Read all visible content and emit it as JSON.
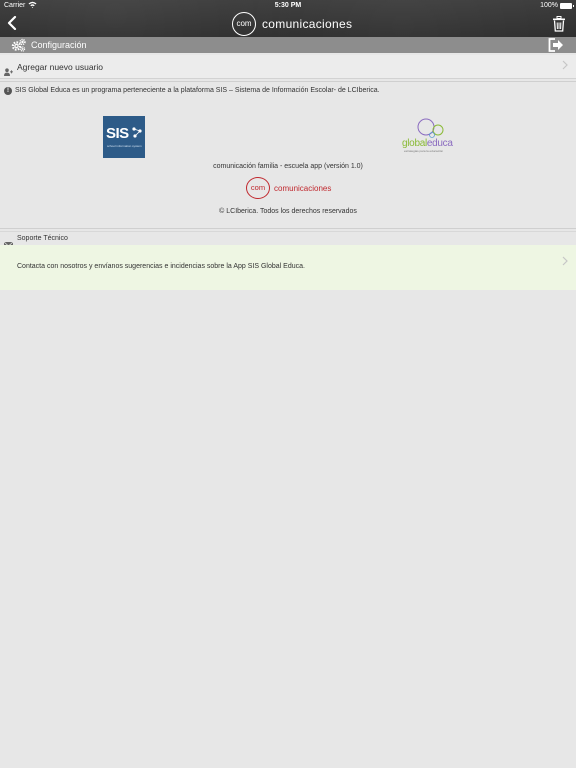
{
  "status_bar": {
    "carrier": "Carrier",
    "time": "5:30 PM",
    "battery": "100%"
  },
  "navbar": {
    "logo_text": "com",
    "title": "comunicaciones",
    "icons": [
      "back-arrow-icon",
      "trash-icon"
    ]
  },
  "config_bar": {
    "label": "Configuración",
    "icons": [
      "gears-icon",
      "logout-icon"
    ]
  },
  "add_user": {
    "label": "Agregar nuevo usuario",
    "icon": "add-user-icon"
  },
  "info": {
    "text": "SIS Global Educa es un programa perteneciente a la plataforma SIS – Sistema de Información Escolar-  de LCIberica."
  },
  "logos": {
    "sis_text": "SIS",
    "sis_sub": "school information system",
    "global_word_1": "global",
    "global_word_2": "educa",
    "global_tag": "estrategias para la educación"
  },
  "about": {
    "app_version": "comunicación familia - escuela app (versión 1.0)",
    "com_logo_text": "com",
    "com_word": "comunicaciones",
    "copyright": "© LCIberica. Todos los derechos reservados"
  },
  "support": {
    "header": "Soporte Técnico",
    "text": "Contacta con nosotros y envíanos sugerencias e incidencias sobre la App SIS Global Educa."
  },
  "colors": {
    "navbar": "#333333",
    "config_bar": "#8d8d8d",
    "support_card": "#eef6e3",
    "brand_red": "#c0282e",
    "sis_blue": "#2d5b88",
    "global_green": "#8aba36",
    "global_purple": "#8a6bc0"
  }
}
